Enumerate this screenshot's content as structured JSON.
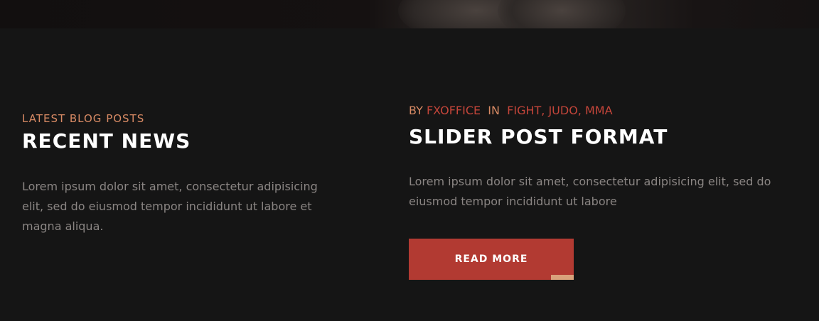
{
  "blog": {
    "eyebrow": "LATEST BLOG POSTS",
    "title": "RECENT NEWS",
    "description": "Lorem ipsum dolor sit amet, consectetur adipisicing elit, sed do eiusmod tempor incididunt ut labore et magna aliqua."
  },
  "post": {
    "by_label": "BY",
    "author": "FXOFFICE",
    "in_label": "IN",
    "categories": [
      "FIGHT",
      "JUDO",
      "MMA"
    ],
    "category_separator": ",",
    "title": "SLIDER POST FORMAT",
    "excerpt": "Lorem ipsum dolor sit amet, consectetur adipisicing elit, sed do eiusmod tempor incididunt ut labore",
    "read_more_label": "READ MORE"
  },
  "colors": {
    "accent_orange": "#d88a64",
    "accent_red": "#b23a32",
    "background": "#151515",
    "muted_text": "#8a8583"
  }
}
